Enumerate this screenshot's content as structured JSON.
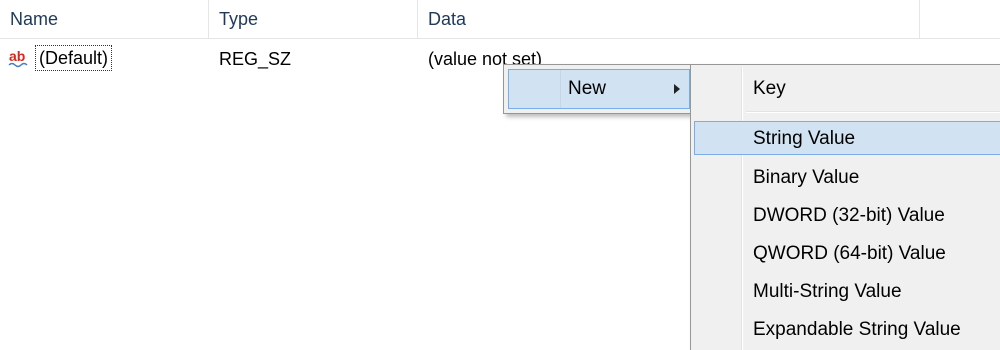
{
  "columns": {
    "name": "Name",
    "type": "Type",
    "data": "Data"
  },
  "rows": [
    {
      "icon": "string-value-ab-icon",
      "name": "(Default)",
      "type": "REG_SZ",
      "data": "(value not set)"
    }
  ],
  "context_menu": {
    "items": [
      {
        "label": "New",
        "has_submenu": true,
        "highlighted": true
      }
    ]
  },
  "submenu": {
    "items": [
      {
        "label": "Key"
      },
      {
        "label": "String Value",
        "highlighted": true
      },
      {
        "label": "Binary Value"
      },
      {
        "label": "DWORD (32-bit) Value"
      },
      {
        "label": "QWORD (64-bit) Value"
      },
      {
        "label": "Multi-String Value"
      },
      {
        "label": "Expandable String Value"
      }
    ]
  },
  "colors": {
    "menu_background": "#f0f0f0",
    "highlight_fill": "#d1e2f2",
    "highlight_border": "#78aee5",
    "header_text": "#1e395b",
    "icon_red": "#d9261c"
  }
}
